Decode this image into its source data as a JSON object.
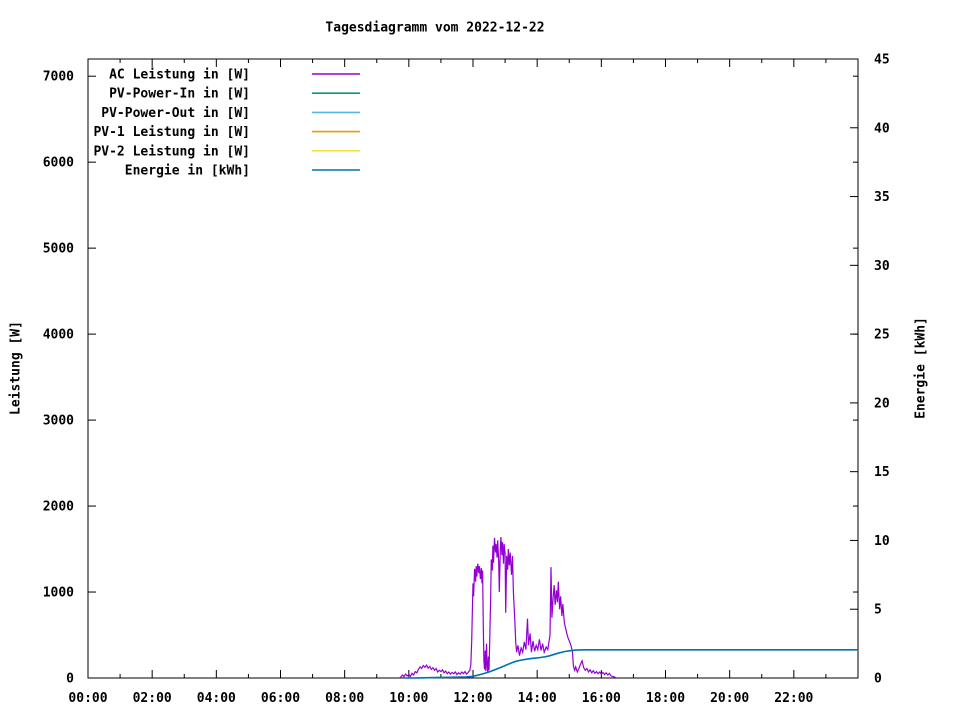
{
  "chart_data": {
    "type": "line",
    "title": "Tagesdiagramm vom 2022-12-22",
    "grid": false,
    "legend_position": "top-left-inside",
    "x_axis": {
      "label": "",
      "unit": "time-of-day",
      "start_hour": 0,
      "end_hour": 24,
      "major_tick_every_hours": 2,
      "minor_tick_every_hours": 1,
      "tick_labels": [
        "00:00",
        "02:00",
        "04:00",
        "06:00",
        "08:00",
        "10:00",
        "12:00",
        "14:00",
        "16:00",
        "18:00",
        "20:00",
        "22:00"
      ]
    },
    "y_left": {
      "label": "Leistung [W]",
      "min": 0,
      "max": 7200,
      "tick_step": 1000,
      "tick_labels": [
        "0",
        "1000",
        "2000",
        "3000",
        "4000",
        "5000",
        "6000",
        "7000"
      ]
    },
    "y_right": {
      "label": "Energie [kWh]",
      "min": 0,
      "max": 45,
      "tick_step": 5,
      "tick_labels": [
        "0",
        "5",
        "10",
        "15",
        "20",
        "25",
        "30",
        "35",
        "40",
        "45"
      ]
    },
    "series": [
      {
        "name": "AC Leistung in [W]",
        "color": "#9400d3",
        "axis": "left",
        "visible": true,
        "points": [
          [
            9.7,
            0
          ],
          [
            9.75,
            10
          ],
          [
            9.8,
            35
          ],
          [
            9.85,
            15
          ],
          [
            9.9,
            45
          ],
          [
            9.95,
            25
          ],
          [
            10.0,
            40
          ],
          [
            10.05,
            20
          ],
          [
            10.1,
            55
          ],
          [
            10.15,
            35
          ],
          [
            10.2,
            75
          ],
          [
            10.25,
            60
          ],
          [
            10.3,
            100
          ],
          [
            10.35,
            130
          ],
          [
            10.4,
            110
          ],
          [
            10.45,
            145
          ],
          [
            10.5,
            125
          ],
          [
            10.55,
            150
          ],
          [
            10.6,
            115
          ],
          [
            10.65,
            135
          ],
          [
            10.7,
            100
          ],
          [
            10.75,
            120
          ],
          [
            10.8,
            90
          ],
          [
            10.85,
            110
          ],
          [
            10.9,
            70
          ],
          [
            10.95,
            90
          ],
          [
            11.0,
            75
          ],
          [
            11.05,
            95
          ],
          [
            11.1,
            60
          ],
          [
            11.15,
            80
          ],
          [
            11.2,
            50
          ],
          [
            11.25,
            70
          ],
          [
            11.3,
            45
          ],
          [
            11.35,
            65
          ],
          [
            11.4,
            50
          ],
          [
            11.45,
            70
          ],
          [
            11.5,
            40
          ],
          [
            11.55,
            60
          ],
          [
            11.6,
            45
          ],
          [
            11.65,
            70
          ],
          [
            11.7,
            50
          ],
          [
            11.75,
            75
          ],
          [
            11.8,
            45
          ],
          [
            11.85,
            65
          ],
          [
            11.9,
            90
          ],
          [
            11.93,
            150
          ],
          [
            11.96,
            430
          ],
          [
            11.98,
            800
          ],
          [
            12.0,
            1100
          ],
          [
            12.02,
            950
          ],
          [
            12.05,
            1270
          ],
          [
            12.08,
            1120
          ],
          [
            12.1,
            1300
          ],
          [
            12.12,
            1180
          ],
          [
            12.15,
            1330
          ],
          [
            12.18,
            1220
          ],
          [
            12.2,
            1300
          ],
          [
            12.23,
            1150
          ],
          [
            12.26,
            1280
          ],
          [
            12.28,
            1100
          ],
          [
            12.3,
            1250
          ],
          [
            12.32,
            600
          ],
          [
            12.34,
            200
          ],
          [
            12.36,
            100
          ],
          [
            12.38,
            320
          ],
          [
            12.4,
            80
          ],
          [
            12.42,
            400
          ],
          [
            12.44,
            150
          ],
          [
            12.46,
            60
          ],
          [
            12.48,
            250
          ],
          [
            12.5,
            90
          ],
          [
            12.52,
            420
          ],
          [
            12.55,
            900
          ],
          [
            12.57,
            1380
          ],
          [
            12.6,
            1250
          ],
          [
            12.62,
            1540
          ],
          [
            12.64,
            1340
          ],
          [
            12.67,
            1630
          ],
          [
            12.7,
            1460
          ],
          [
            12.72,
            1560
          ],
          [
            12.75,
            1400
          ],
          [
            12.77,
            1600
          ],
          [
            12.8,
            1350
          ],
          [
            12.82,
            1000
          ],
          [
            12.85,
            1480
          ],
          [
            12.87,
            1640
          ],
          [
            12.9,
            1430
          ],
          [
            12.92,
            1580
          ],
          [
            12.95,
            1330
          ],
          [
            12.97,
            1560
          ],
          [
            13.0,
            1450
          ],
          [
            13.02,
            760
          ],
          [
            13.05,
            1420
          ],
          [
            13.08,
            1260
          ],
          [
            13.1,
            1500
          ],
          [
            13.13,
            1310
          ],
          [
            13.16,
            1460
          ],
          [
            13.2,
            1200
          ],
          [
            13.23,
            1420
          ],
          [
            13.26,
            1000
          ],
          [
            13.3,
            700
          ],
          [
            13.33,
            420
          ],
          [
            13.36,
            300
          ],
          [
            13.4,
            380
          ],
          [
            13.45,
            260
          ],
          [
            13.5,
            350
          ],
          [
            13.55,
            300
          ],
          [
            13.6,
            420
          ],
          [
            13.65,
            330
          ],
          [
            13.7,
            690
          ],
          [
            13.73,
            380
          ],
          [
            13.78,
            520
          ],
          [
            13.82,
            300
          ],
          [
            13.87,
            430
          ],
          [
            13.92,
            310
          ],
          [
            13.97,
            380
          ],
          [
            14.02,
            330
          ],
          [
            14.07,
            450
          ],
          [
            14.12,
            320
          ],
          [
            14.17,
            400
          ],
          [
            14.22,
            300
          ],
          [
            14.28,
            360
          ],
          [
            14.33,
            330
          ],
          [
            14.4,
            500
          ],
          [
            14.43,
            1290
          ],
          [
            14.46,
            700
          ],
          [
            14.5,
            950
          ],
          [
            14.53,
            1080
          ],
          [
            14.56,
            850
          ],
          [
            14.6,
            1020
          ],
          [
            14.63,
            880
          ],
          [
            14.66,
            1120
          ],
          [
            14.7,
            800
          ],
          [
            14.73,
            950
          ],
          [
            14.77,
            720
          ],
          [
            14.8,
            860
          ],
          [
            14.85,
            640
          ],
          [
            14.9,
            560
          ],
          [
            14.95,
            480
          ],
          [
            15.0,
            430
          ],
          [
            15.05,
            380
          ],
          [
            15.1,
            300
          ],
          [
            15.13,
            140
          ],
          [
            15.17,
            90
          ],
          [
            15.2,
            130
          ],
          [
            15.25,
            70
          ],
          [
            15.3,
            110
          ],
          [
            15.35,
            160
          ],
          [
            15.4,
            200
          ],
          [
            15.45,
            120
          ],
          [
            15.5,
            90
          ],
          [
            15.55,
            110
          ],
          [
            15.6,
            70
          ],
          [
            15.65,
            95
          ],
          [
            15.7,
            60
          ],
          [
            15.75,
            85
          ],
          [
            15.8,
            55
          ],
          [
            15.85,
            75
          ],
          [
            15.9,
            50
          ],
          [
            15.95,
            70
          ],
          [
            16.0,
            45
          ],
          [
            16.05,
            65
          ],
          [
            16.1,
            40
          ],
          [
            16.15,
            60
          ],
          [
            16.2,
            35
          ],
          [
            16.25,
            55
          ],
          [
            16.3,
            25
          ],
          [
            16.38,
            15
          ],
          [
            16.45,
            5
          ]
        ]
      },
      {
        "name": "PV-Power-In in [W]",
        "color": "#009e73",
        "axis": "left",
        "visible": false,
        "points": []
      },
      {
        "name": "PV-Power-Out in [W]",
        "color": "#56b4e9",
        "axis": "left",
        "visible": false,
        "points": []
      },
      {
        "name": "PV-1 Leistung in [W]",
        "color": "#e69f00",
        "axis": "left",
        "visible": false,
        "points": []
      },
      {
        "name": "PV-2 Leistung in [W]",
        "color": "#f0e442",
        "axis": "left",
        "visible": false,
        "points": []
      },
      {
        "name": "Energie in [kWh]",
        "color": "#0072b2",
        "axis": "right",
        "visible": true,
        "points": [
          [
            9.9,
            0
          ],
          [
            10.3,
            0.01
          ],
          [
            10.8,
            0.03
          ],
          [
            11.3,
            0.05
          ],
          [
            11.8,
            0.08
          ],
          [
            12.0,
            0.12
          ],
          [
            12.15,
            0.2
          ],
          [
            12.3,
            0.3
          ],
          [
            12.45,
            0.4
          ],
          [
            12.6,
            0.52
          ],
          [
            12.75,
            0.66
          ],
          [
            12.9,
            0.8
          ],
          [
            13.05,
            0.95
          ],
          [
            13.2,
            1.1
          ],
          [
            13.35,
            1.22
          ],
          [
            13.5,
            1.3
          ],
          [
            13.65,
            1.36
          ],
          [
            13.8,
            1.41
          ],
          [
            13.95,
            1.45
          ],
          [
            14.1,
            1.49
          ],
          [
            14.25,
            1.54
          ],
          [
            14.4,
            1.62
          ],
          [
            14.55,
            1.73
          ],
          [
            14.7,
            1.83
          ],
          [
            14.85,
            1.92
          ],
          [
            15.0,
            1.98
          ],
          [
            15.15,
            2.02
          ],
          [
            15.3,
            2.04
          ],
          [
            15.5,
            2.05
          ],
          [
            16.0,
            2.05
          ],
          [
            24.0,
            2.05
          ]
        ]
      }
    ],
    "colors": {
      "axis": "#000000",
      "background": "#ffffff",
      "text": "#000000"
    }
  }
}
